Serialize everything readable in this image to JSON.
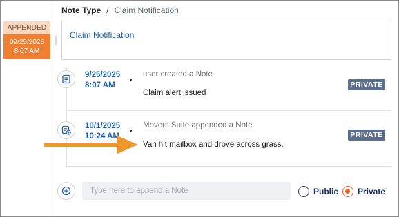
{
  "rail": {
    "status": "APPENDED",
    "date": "09/25/2025",
    "time": "8:07 AM"
  },
  "breadcrumb": {
    "parent": "Note Type",
    "separator": "/",
    "current": "Claim Notification"
  },
  "header_card": {
    "title": "Claim Notification"
  },
  "entries": [
    {
      "icon": "note-icon",
      "date": "9/25/2025",
      "time": "8:07 AM",
      "actor": "user",
      "action": "created a Note",
      "message": "Claim alert issued",
      "visibility": "PRIVATE"
    },
    {
      "icon": "note-append-icon",
      "date": "10/1/2025",
      "time": "10:24 AM",
      "actor": "Movers Suite",
      "action": "appended a Note",
      "message": "Van hit mailbox and drove across grass.",
      "visibility": "PRIVATE"
    }
  ],
  "composer": {
    "icon": "add-circle-icon",
    "placeholder": "Type here to append a Note",
    "value": "",
    "options": [
      {
        "label": "Public",
        "selected": false
      },
      {
        "label": "Private",
        "selected": true
      }
    ]
  },
  "colors": {
    "accent_orange": "#ef8033",
    "badge_peach": "#fbd7bd",
    "link_blue": "#1f5ea8",
    "pill_slate": "#5a6d8c",
    "arrow_orange": "#f0962a",
    "radio_selected": "#ef5a28",
    "radio_navy": "#2a3a6c"
  }
}
